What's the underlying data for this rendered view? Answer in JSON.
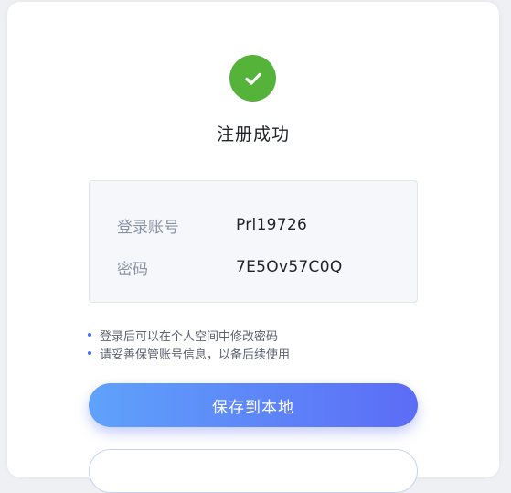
{
  "dialog": {
    "title": "注册成功"
  },
  "account_info": {
    "username_label": "登录账号",
    "username_value": "Prl19726",
    "password_label": "密码",
    "password_value": "7E5Ov57C0Q"
  },
  "tips": [
    "登录后可以在个人空间中修改密码",
    "请妥善保管账号信息，以备后续使用"
  ],
  "actions": {
    "save_label": "保存到本地"
  },
  "colors": {
    "success": "#56b33a",
    "accent_start": "#5fa2fb",
    "accent_end": "#5c6cf6"
  }
}
